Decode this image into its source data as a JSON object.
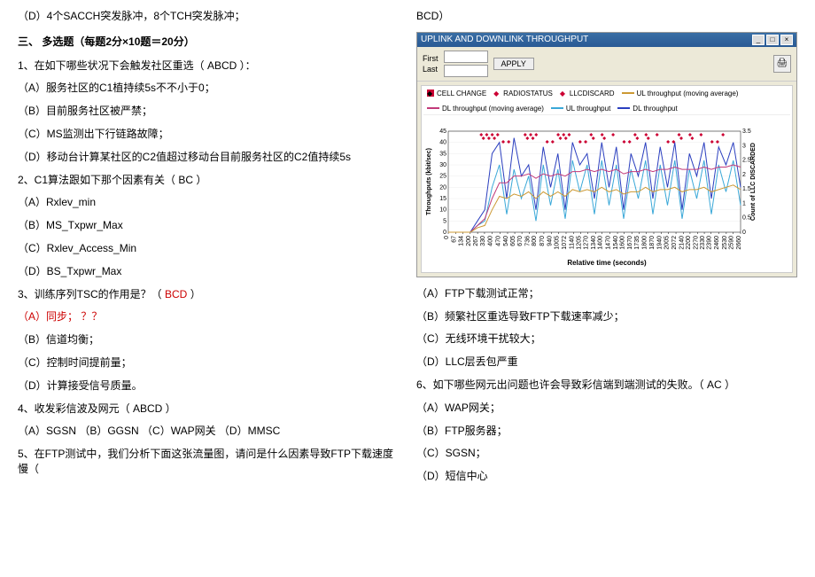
{
  "left": {
    "intro_line": "（D）4个SACCH突发脉冲，8个TCH突发脉冲；",
    "section_title": "三、 多选题（每题2分×10题＝20分）",
    "q1": "1、在如下哪些状况下会触发社区重选（ ABCD  ）：",
    "q1a": "（A）服务社区的C1植持续5s不不小于0；",
    "q1b": "（B）目前服务社区被严禁；",
    "q1c": "（C）MS监测出下行链路故障；",
    "q1d": "（D）移动台计算某社区的C2值超过移动台目前服务社区的C2值持续5s",
    "q2": "2、C1算法跟如下那个因素有关（  BC  ）",
    "q2a": "（A）Rxlev_min",
    "q2b": "（B）MS_Txpwr_Max",
    "q2c": "（C）Rxlev_Access_Min",
    "q2d": "（D）BS_Txpwr_Max",
    "q3": "3、训练序列TSC的作用是？（ ",
    "q3_bcd": " BCD   ",
    "q3_end": "）",
    "q3a": "（A）同步； ？？",
    "q3b": "（B）信道均衡；",
    "q3c": "（C）控制时间提前量；",
    "q3d": "（D）计算接受信号质量。",
    "q4": "4、收发彩信波及网元（ ABCD ）",
    "q4opts": "（A）SGSN   （B）GGSN   （C）WAP网关  （D）MMSC",
    "q5": "5、在FTP测试中，我们分析下面这张流量图，请问是什么因素导致FTP下载速度慢（"
  },
  "right": {
    "bcd": "BCD）",
    "chart_window_title": "UPLINK AND DOWNLINK THROUGHPUT",
    "first_label": "First",
    "last_label": "Last",
    "apply_label": "APPLY",
    "legend": {
      "cell_change": "CELL CHANGE",
      "radio_status": "RADIOSTATUS",
      "llc_discard": "LLCDISCARD",
      "ul_ma": "UL throughput (moving average)",
      "dl_ma": "DL throughput (moving average)",
      "ul": "UL throughput",
      "dl": "DL throughput"
    },
    "xlabel": "Relative time (seconds)",
    "ylabel_left": "Throughputs (kbit/sec)",
    "ylabel_right": "Count of LLC DISCARDED",
    "q5a": "（A）FTP下载测试正常；",
    "q5b": "（B）频繁社区重选导致FTP下载速率减少；",
    "q5c": "（C）无线环境干扰较大；",
    "q5d": "（D）LLC层丢包严重",
    "q6": "6、如下哪些网元出问题也许会导致彩信端到端测试的失败。（ AC   ）",
    "q6a": "（A）WAP网关；",
    "q6b": "（B）FTP服务器；",
    "q6c": "（C）SGSN；",
    "q6d": "（D）短信中心"
  },
  "chart_data": {
    "type": "line",
    "title": "UPLINK AND DOWNLINK THROUGHPUT",
    "xlabel": "Relative time (seconds)",
    "ylabel_left": "Throughputs (kbit/sec)",
    "ylabel_right": "Count of LLC DISCARDED",
    "ylim_left": [
      0,
      45
    ],
    "ylim_right": [
      0,
      3.5
    ],
    "yticks_left": [
      0,
      5,
      10,
      15,
      20,
      25,
      30,
      35,
      40,
      45
    ],
    "yticks_right": [
      0,
      0.5,
      1,
      1.5,
      2,
      2.5,
      3,
      3.5
    ],
    "xticks": [
      0,
      67,
      134,
      200,
      267,
      330,
      400,
      470,
      540,
      605,
      670,
      736,
      800,
      870,
      940,
      1005,
      1072,
      1140,
      1205,
      1270,
      1340,
      1400,
      1470,
      1540,
      1600,
      1670,
      1735,
      1800,
      1870,
      1940,
      2005,
      2072,
      2140,
      2200,
      2270,
      2330,
      2390,
      2460,
      2530,
      2590,
      2660
    ],
    "series": [
      {
        "name": "DL throughput",
        "color": "#2b3fbf",
        "sample_values": [
          0,
          0,
          0,
          0,
          5,
          10,
          35,
          40,
          15,
          42,
          25,
          30,
          10,
          38,
          20,
          35,
          10,
          40,
          30,
          35,
          15,
          40,
          20,
          38,
          10,
          35,
          25,
          40,
          15,
          38,
          20,
          40,
          10,
          35,
          25,
          40,
          15,
          38,
          30,
          40,
          20
        ]
      },
      {
        "name": "UL throughput",
        "color": "#3aa8d8",
        "sample_values": [
          0,
          0,
          0,
          0,
          3,
          5,
          20,
          30,
          8,
          28,
          15,
          25,
          5,
          30,
          12,
          28,
          6,
          32,
          18,
          30,
          8,
          32,
          12,
          30,
          6,
          28,
          15,
          32,
          8,
          30,
          12,
          32,
          6,
          28,
          15,
          32,
          8,
          30,
          18,
          32,
          12
        ]
      },
      {
        "name": "DL throughput (moving average)",
        "color": "#c23a7a",
        "sample_values": [
          0,
          0,
          0,
          0,
          3,
          6,
          15,
          22,
          22,
          25,
          25,
          26,
          24,
          26,
          25,
          26,
          25,
          27,
          27,
          28,
          27,
          28,
          27,
          28,
          26,
          27,
          27,
          28,
          27,
          28,
          28,
          29,
          28,
          28,
          28,
          29,
          28,
          29,
          29,
          30,
          29
        ]
      },
      {
        "name": "UL throughput (moving average)",
        "color": "#c93",
        "sample_values": [
          0,
          0,
          0,
          0,
          2,
          3,
          10,
          16,
          15,
          17,
          16,
          18,
          15,
          18,
          16,
          18,
          16,
          19,
          18,
          19,
          18,
          20,
          18,
          19,
          17,
          18,
          18,
          20,
          18,
          19,
          19,
          20,
          18,
          19,
          19,
          20,
          18,
          19,
          20,
          21,
          19
        ]
      }
    ],
    "markers": [
      {
        "name": "CELL CHANGE",
        "color": "#c03",
        "x": [
          300,
          350,
          400,
          450,
          700,
          750,
          800,
          1000,
          1050,
          1100,
          1300,
          1400,
          1500,
          1700,
          1800,
          1900,
          2100,
          2200,
          2300,
          2500
        ]
      },
      {
        "name": "RADIOSTATUS",
        "color": "#c03",
        "x": [
          320,
          370,
          420,
          720,
          770,
          1020,
          1070,
          1320,
          1420,
          1720,
          1820,
          2120,
          2220
        ]
      },
      {
        "name": "LLCDISCARD",
        "color": "#c03",
        "x": [
          500,
          550,
          900,
          950,
          1200,
          1250,
          1600,
          1650,
          2000,
          2050,
          2400,
          2450
        ]
      }
    ]
  }
}
